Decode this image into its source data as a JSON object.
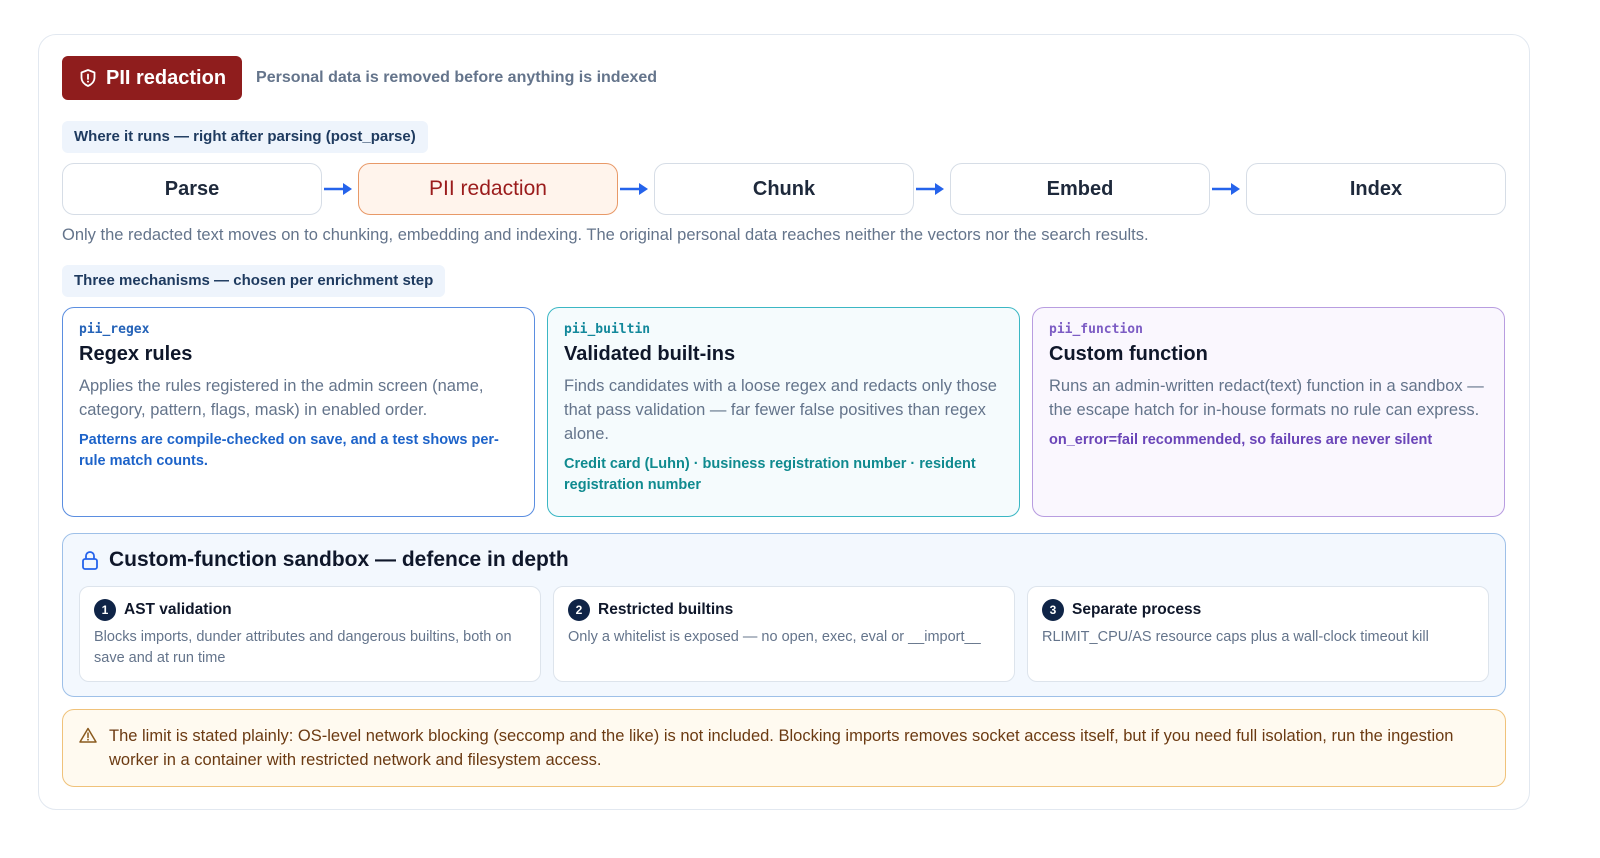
{
  "header": {
    "badge_label": "PII redaction",
    "badge_icon": "shield-icon",
    "subtitle": "Personal data is removed before anything is indexed"
  },
  "where": {
    "label": "Where it runs — right after parsing (post_parse)"
  },
  "pipeline": {
    "steps": [
      "Parse",
      "PII redaction",
      "Chunk",
      "Embed",
      "Index"
    ],
    "active_step": "PII redaction",
    "arrow_color": "#2563eb"
  },
  "note": "Only the redacted text moves on to chunking, embedding and indexing. The original personal data reaches neither the vectors nor the search results.",
  "mechanisms": {
    "label": "Three mechanisms — chosen per enrichment step",
    "items": [
      {
        "code": "pii_regex",
        "title": "Regex rules",
        "description": "Applies the rules registered in the admin screen (name, category, pattern, flags, mask) in enabled order.",
        "highlight": "Patterns are compile-checked on save, and a test shows per-rule match counts.",
        "accent": "#2563b8"
      },
      {
        "code": "pii_builtin",
        "title": "Validated built-ins",
        "description": "Finds candidates with a loose regex and redacts only those that pass validation — far fewer false positives than regex alone.",
        "highlight": "Credit card (Luhn) · business registration number · resident registration number",
        "accent": "#12889b"
      },
      {
        "code": "pii_function",
        "title": "Custom function",
        "description": "Runs an admin-written redact(text) function in a sandbox — the escape hatch for in-house formats no rule can express.",
        "highlight": "on_error=fail recommended, so failures are never silent",
        "accent": "#7c5cc4"
      }
    ]
  },
  "sandbox": {
    "title": "Custom-function sandbox — defence in depth",
    "icon": "lock-icon",
    "layers": [
      {
        "num": "1",
        "title": "AST validation",
        "description": "Blocks imports, dunder attributes and dangerous builtins, both on save and at run time"
      },
      {
        "num": "2",
        "title": "Restricted builtins",
        "description": "Only a whitelist is exposed — no open, exec, eval or __import__"
      },
      {
        "num": "3",
        "title": "Separate process",
        "description": "RLIMIT_CPU/AS resource caps plus a wall-clock timeout kill"
      }
    ]
  },
  "warning": {
    "icon": "warning-icon",
    "text": "The limit is stated plainly: OS-level network blocking (seccomp and the like) is not included. Blocking imports removes socket access itself, but if you need full isolation, run the ingestion worker in a container with restricted network and filesystem access."
  }
}
